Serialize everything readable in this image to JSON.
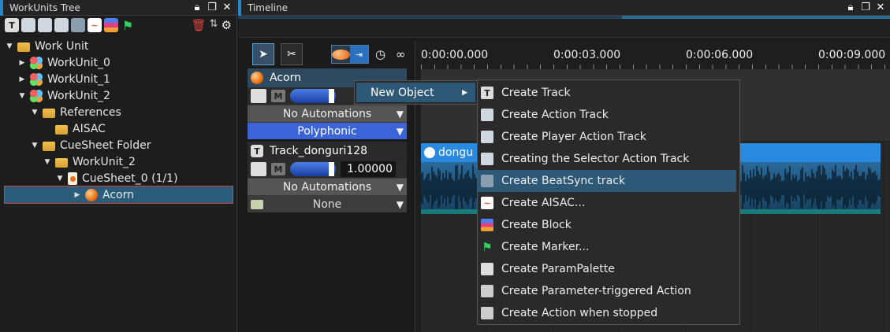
{
  "left_panel": {
    "title": "WorkUnits Tree",
    "tree": [
      {
        "label": "Work Unit",
        "level": 0,
        "arrow": "▼",
        "icon": "folder"
      },
      {
        "label": "WorkUnit_0",
        "level": 1,
        "arrow": "▶",
        "icon": "workunit"
      },
      {
        "label": "WorkUnit_1",
        "level": 1,
        "arrow": "▶",
        "icon": "workunit"
      },
      {
        "label": "WorkUnit_2",
        "level": 1,
        "arrow": "▼",
        "icon": "workunit"
      },
      {
        "label": "References",
        "level": 2,
        "arrow": "▼",
        "icon": "folder"
      },
      {
        "label": "AISAC",
        "level": 3,
        "arrow": "",
        "icon": "folder"
      },
      {
        "label": "CueSheet Folder",
        "level": 2,
        "arrow": "▼",
        "icon": "folder"
      },
      {
        "label": "WorkUnit_2",
        "level": 3,
        "arrow": "▼",
        "icon": "folder"
      },
      {
        "label": "CueSheet_0 (1/1)",
        "level": 4,
        "arrow": "▼",
        "icon": "cuesheet"
      },
      {
        "label": "Acorn",
        "level": 5,
        "arrow": "▶",
        "icon": "cue",
        "selected": true
      }
    ]
  },
  "timeline": {
    "title": "Timeline",
    "ruler_labels": [
      "0:00:00.000",
      "0:00:03.000",
      "0:00:06.000",
      "0:00:09.000"
    ],
    "tracks": [
      {
        "name": "Acorn",
        "automation": "No Automations",
        "mode": "Polyphonic"
      },
      {
        "name": "Track_donguri128",
        "volume": "1.00000",
        "automation": "No Automations",
        "mode": "None"
      }
    ],
    "clip_label": "dongu"
  },
  "submenu": {
    "label": "New Object"
  },
  "menu": {
    "items": [
      {
        "label": "Create Track",
        "icon": "track-icon"
      },
      {
        "label": "Create Action Track",
        "icon": "action-track-icon"
      },
      {
        "label": "Create Player Action Track",
        "icon": "player-action-track-icon"
      },
      {
        "label": "Creating the Selector Action Track",
        "icon": "selector-action-track-icon"
      },
      {
        "label": "Create BeatSync track",
        "icon": "beatsync-icon",
        "highlighted": true
      },
      {
        "label": "Create AISAC...",
        "icon": "aisac-icon"
      },
      {
        "label": "Create Block",
        "icon": "block-icon"
      },
      {
        "label": "Create Marker...",
        "icon": "flag-icon"
      },
      {
        "label": "Create ParamPalette",
        "icon": "param-palette-icon"
      },
      {
        "label": "Create Parameter-triggered Action",
        "icon": "parameter-action-icon"
      },
      {
        "label": "Create Action when stopped",
        "icon": "stop-action-icon"
      }
    ]
  },
  "colors": {
    "accent": "#2a84c8",
    "highlight": "#2d5876",
    "polyphonic": "#3a64d8",
    "clip": "#2a8ae0"
  }
}
